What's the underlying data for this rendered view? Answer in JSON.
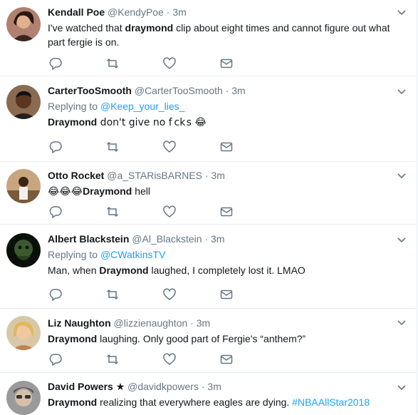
{
  "tweets": [
    {
      "name": "Kendall Poe",
      "handle": "@KendyPoe",
      "sep": "·",
      "time": "3m",
      "reply_to_prefix": "",
      "reply_to": "",
      "text": [
        "I've watched that ",
        "draymond",
        " clip about eight times and cannot figure out what part fergie is on."
      ]
    },
    {
      "name": "CarterTooSmooth",
      "handle": "@CarterTooSmooth",
      "sep": "·",
      "time": "3m",
      "reply_to_prefix": "Replying to ",
      "reply_to": "@Keep_your_lies_",
      "text": [
        "",
        "Draymond",
        " don't give no f  ck s 😂"
      ]
    },
    {
      "name": "Otto Rocket",
      "handle": "@a_STARisBARNES",
      "sep": "·",
      "time": "3m",
      "reply_to_prefix": "",
      "reply_to": "",
      "text": [
        "😂😂😂",
        "Draymond",
        " hell"
      ]
    },
    {
      "name": "Albert Blackstein",
      "handle": "@Al_Blackstein",
      "sep": "·",
      "time": "3m",
      "reply_to_prefix": "Replying to ",
      "reply_to": "@CWatkinsTV",
      "text": [
        "Man, when ",
        "Draymond",
        " laughed, I completely lost it. LMAO"
      ]
    },
    {
      "name": "Liz Naughton",
      "handle": "@lizzienaughton",
      "sep": "·",
      "time": "3m",
      "reply_to_prefix": "",
      "reply_to": "",
      "text": [
        "",
        "Draymond",
        " laughing. Only good part of Fergie's “anthem?”"
      ]
    },
    {
      "name": "David Powers ★",
      "handle": "@davidkpowers",
      "sep": "·",
      "time": "3m",
      "reply_to_prefix": "",
      "reply_to": "",
      "text": [
        "",
        "Draymond",
        " realizing that everywhere eagles are dying. "
      ],
      "hashtag": "#NBAAllStar2018"
    }
  ],
  "icons": {
    "reply": "reply-icon",
    "retweet": "retweet-icon",
    "like": "like-icon",
    "dm": "direct-message-icon",
    "caret": "chevron-down-icon"
  },
  "colors": {
    "icon": "#657786",
    "link": "#1da1f2",
    "divider": "#e6ecf0"
  }
}
